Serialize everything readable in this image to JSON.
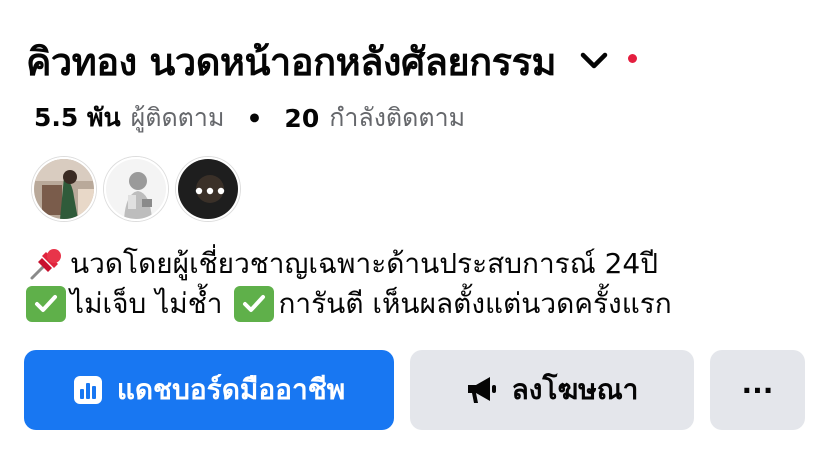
{
  "page": {
    "title": "คิวทอง นวดหน้าอกหลังศัลยกรรม",
    "chevron_icon": "chevron-down-icon",
    "notification_color": "#e41e3f"
  },
  "stats": {
    "followers_count": "5.5 พัน",
    "followers_label": "ผู้ติดตาม",
    "separator": "•",
    "following_count": "20",
    "following_label": "กำลังติดตาม"
  },
  "followers_preview": [
    {
      "icon": "avatar-photo-1"
    },
    {
      "icon": "avatar-photo-2"
    },
    {
      "icon": "more-horizontal-icon",
      "label": "•••"
    }
  ],
  "bio": {
    "line1": "นวดโดยผู้เชี่ยวชาญเฉพาะด้านประสบการณ์ 24ปี",
    "line2_a": "ไม่เจ็บ ไม่ช้ำ",
    "line2_b": "การันตี เห็นผลตั้งแต่นวดครั้งแรก",
    "line1_icon": "pushpin-icon",
    "check_icon": "check-mark-button-icon",
    "check_color": "#5fb04a"
  },
  "actions": {
    "dashboard_label": "แดชบอร์ดมืออาชีพ",
    "dashboard_icon": "bar-chart-icon",
    "advertise_label": "ลงโฆษณา",
    "advertise_icon": "megaphone-icon",
    "more_label": "···",
    "primary_color": "#1877f2",
    "secondary_color": "#e4e6eb"
  }
}
